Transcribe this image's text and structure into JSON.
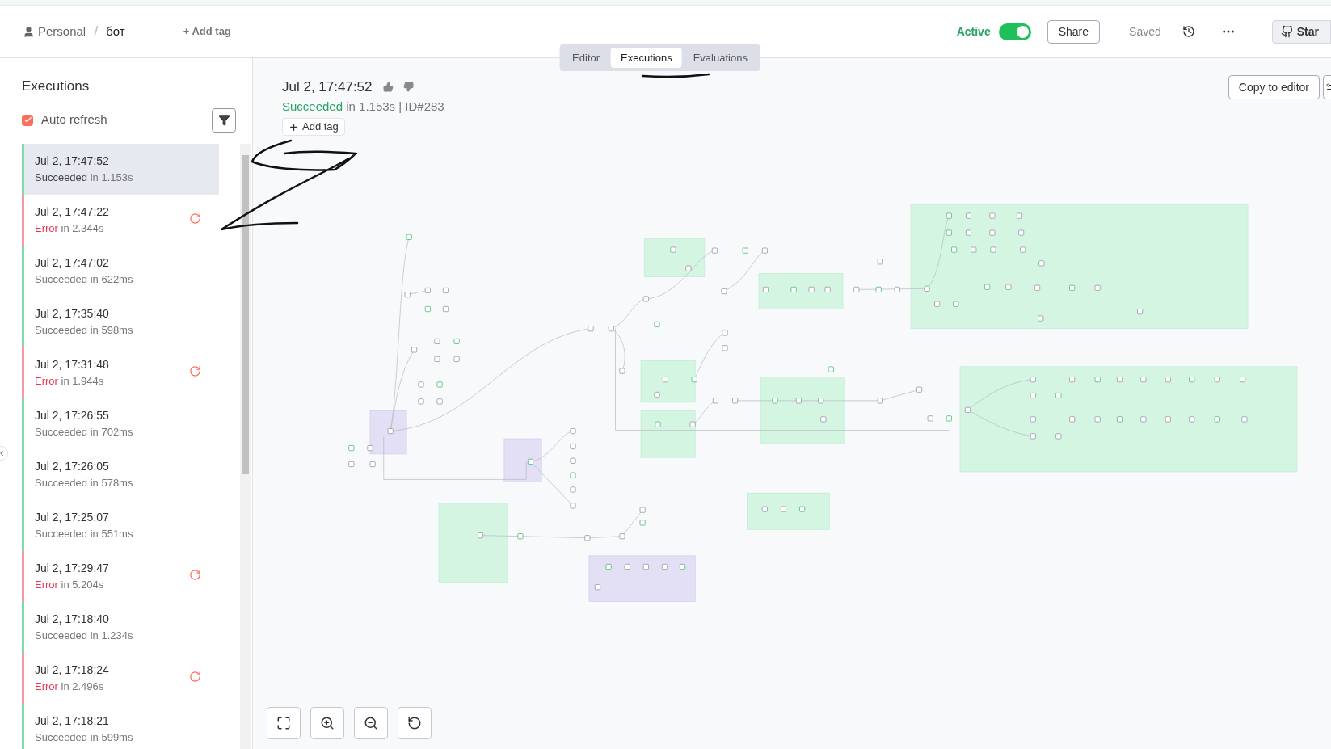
{
  "header": {
    "owner": "Personal",
    "separator": "/",
    "workflow_name": "бот",
    "add_tag": "+ Add tag",
    "active": {
      "label": "Active",
      "on": true
    },
    "share": "Share",
    "saved": "Saved",
    "star": "Star"
  },
  "tabs": [
    {
      "label": "Editor",
      "selected": false
    },
    {
      "label": "Executions",
      "selected": true
    },
    {
      "label": "Evaluations",
      "selected": false
    }
  ],
  "sidebar": {
    "title": "Executions",
    "auto_refresh": {
      "label": "Auto refresh",
      "checked": true
    },
    "executions": [
      {
        "time": "Jul 2, 17:47:52",
        "kind": "success",
        "status": "Succeeded",
        "detail": "in 1.153s",
        "selected": true
      },
      {
        "time": "Jul 2, 17:47:22",
        "kind": "error",
        "status": "Error",
        "detail": "in 2.344s",
        "selected": false
      },
      {
        "time": "Jul 2, 17:47:02",
        "kind": "success",
        "status": "Succeeded",
        "detail": "in 622ms",
        "selected": false
      },
      {
        "time": "Jul 2, 17:35:40",
        "kind": "success",
        "status": "Succeeded",
        "detail": "in 598ms",
        "selected": false
      },
      {
        "time": "Jul 2, 17:31:48",
        "kind": "error",
        "status": "Error",
        "detail": "in 1.944s",
        "selected": false
      },
      {
        "time": "Jul 2, 17:26:55",
        "kind": "success",
        "status": "Succeeded",
        "detail": "in 702ms",
        "selected": false
      },
      {
        "time": "Jul 2, 17:26:05",
        "kind": "success",
        "status": "Succeeded",
        "detail": "in 578ms",
        "selected": false
      },
      {
        "time": "Jul 2, 17:25:07",
        "kind": "success",
        "status": "Succeeded",
        "detail": "in 551ms",
        "selected": false
      },
      {
        "time": "Jul 2, 17:29:47",
        "kind": "error",
        "status": "Error",
        "detail": "in 5.204s",
        "selected": false
      },
      {
        "time": "Jul 2, 17:18:40",
        "kind": "success",
        "status": "Succeeded",
        "detail": "in 1.234s",
        "selected": false
      },
      {
        "time": "Jul 2, 17:18:24",
        "kind": "error",
        "status": "Error",
        "detail": "in 2.496s",
        "selected": false
      },
      {
        "time": "Jul 2, 17:18:21",
        "kind": "success",
        "status": "Succeeded",
        "detail": "in 599ms",
        "selected": false
      }
    ]
  },
  "execution": {
    "time": "Jul 2, 17:47:52",
    "kind": "success",
    "status": "Succeeded",
    "detail": "in 1.153s | ID#283",
    "add_tag": "Add tag",
    "copy_to_editor": "Copy to editor"
  }
}
